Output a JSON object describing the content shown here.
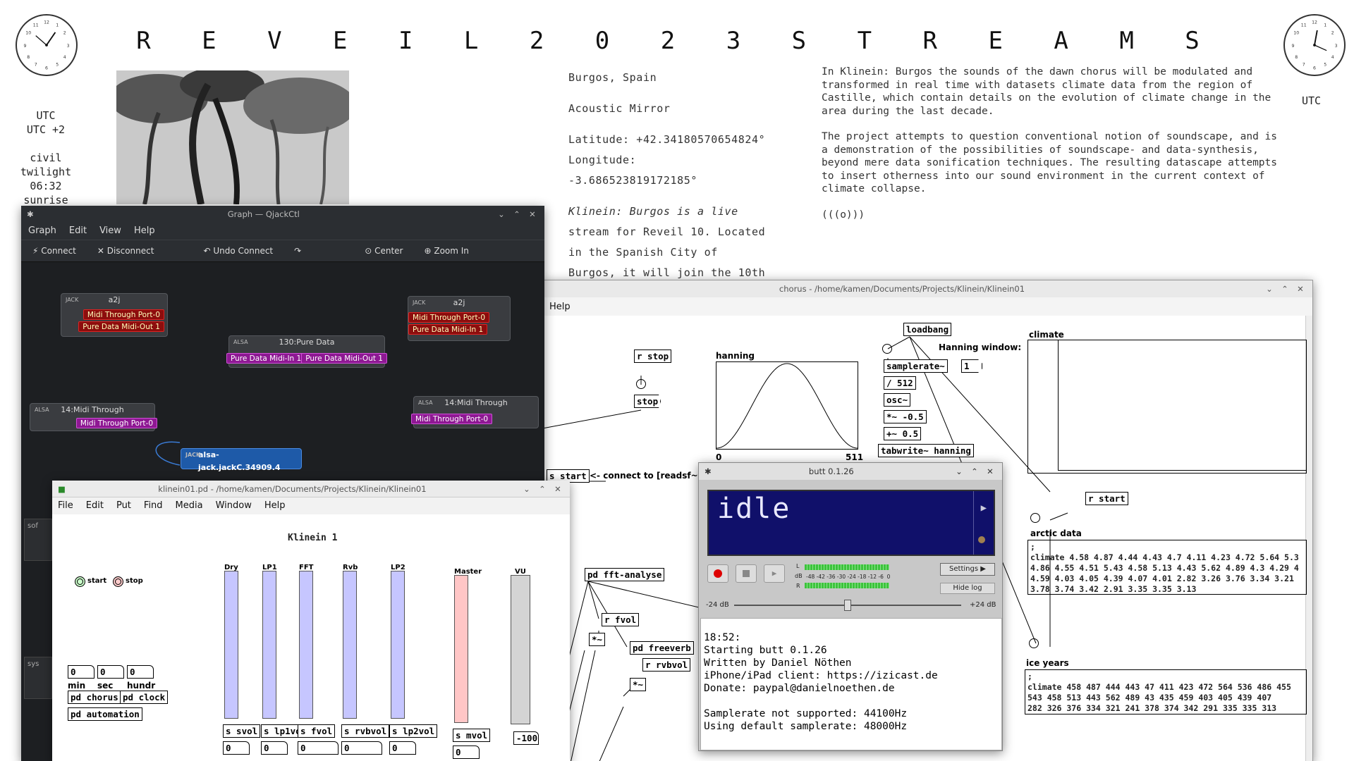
{
  "page": {
    "title": "R E V E I L   2 0 2 3   S T R E A M S",
    "left_labels": [
      "UTC",
      "UTC +2",
      "",
      "civil",
      "twilight",
      "06:32",
      "sunrise"
    ],
    "right_label": "UTC",
    "info_lines": [
      "Burgos, Spain",
      "",
      "Acoustic Mirror",
      "",
      "Latitude: +42.34180570654824°",
      "Longitude:",
      "-3.686523819172185°",
      "",
      "Klinein: Burgos is a live",
      "stream for Reveil 10. Located",
      "in the Spanish City of",
      "Burgos, it will join the 10th"
    ],
    "desc_p1": "In Klinein: Burgos the sounds of the dawn chorus will be modulated and transformed in real time with datasets climate data from the region of Castille, which contain details on the evolution of climate change in the area during the last decade.",
    "desc_p2": "The project attempts to question conventional notion of soundscape, and is a demonstration of the possibilities of soundscape- and data-synthesis, beyond mere data sonification techniques. The resulting datascape attempts to insert otherness into our sound environment in the current context of climate collapse.",
    "desc_p3": "(((o)))"
  },
  "qjackctl": {
    "title": "Graph — QjackCtl",
    "menu": [
      "Graph",
      "Edit",
      "View",
      "Help"
    ],
    "toolbar": {
      "connect": "Connect",
      "disconnect": "Disconnect",
      "undo": "Undo Connect",
      "center": "Center",
      "zoom_in": "Zoom In"
    },
    "nodes": {
      "a2j_left": {
        "name": "a2j",
        "ports": [
          "Midi Through Port-0",
          "Pure Data Midi-Out 1"
        ]
      },
      "a2j_right": {
        "name": "a2j",
        "ports": [
          "Midi Through Port-0",
          "Pure Data Midi-In 1"
        ]
      },
      "pure_data": {
        "name": "130:Pure Data",
        "ports": [
          "Pure Data Midi-In 1",
          "Pure Data Midi-Out 1"
        ]
      },
      "midi_left": {
        "name": "14:Midi Through",
        "ports": [
          "Midi Through Port-0"
        ]
      },
      "midi_right": {
        "name": "14:Midi Through",
        "ports": [
          "Midi Through Port-0"
        ]
      },
      "alsa": {
        "name": "alsa-jack.jackC.34909.4"
      },
      "side": [
        "sof",
        "sys"
      ]
    }
  },
  "pd_main": {
    "title": "klinein01.pd  - /home/kamen/Documents/Projects/Klinein/Klinein01",
    "menu": [
      "File",
      "Edit",
      "Put",
      "Find",
      "Media",
      "Window",
      "Help"
    ],
    "heading": "Klinein 1",
    "start": "start",
    "stop": "stop",
    "channels": [
      {
        "label": "Dry",
        "send": "s svol",
        "value": "0"
      },
      {
        "label": "LP1",
        "send": "s lp1vol",
        "value": "0"
      },
      {
        "label": "FFT",
        "send": "s fvol",
        "value": "0"
      },
      {
        "label": "Rvb",
        "send": "s rvbvol",
        "value": "0"
      },
      {
        "label": "LP2",
        "send": "s lp2vol",
        "value": "0"
      },
      {
        "label": "Master",
        "send": "s mvol",
        "value": "0"
      }
    ],
    "vu_label": "VU",
    "vu_value": "-100",
    "time_values": [
      "0",
      "0",
      "0"
    ],
    "time_labels": [
      "min",
      "sec",
      "hundr"
    ],
    "buttons": [
      "pd chorus",
      "pd clock",
      "pd automation"
    ]
  },
  "pd_chorus": {
    "title": "chorus  - /home/kamen/Documents/Projects/Klinein/Klinein01",
    "menu_help": "Help",
    "objects": {
      "r_stop": "r stop",
      "stop_msg": "stop",
      "hanning": "hanning",
      "h0": "0",
      "h511": "511",
      "loadbang": "loadbang",
      "hanning_window": "Hanning window:",
      "samplerate": "samplerate~",
      "one": "1",
      "div512": "/ 512",
      "osc": "osc~",
      "mul": "*~ -0.5",
      "add": "+~ 0.5",
      "tabwrite": "tabwrite~ hanning",
      "climate": "climate",
      "r_start": "r start",
      "s_start": "s start",
      "connect_note": "<- connect to [readsf~",
      "pd_fft": "pd fft-analyse",
      "r_fvol": "r fvol",
      "pd_freeverb": "pd freeverb",
      "r_rvbvol": "r rvbvol",
      "mul1": "*~",
      "mul2": "*~",
      "arctic": "arctic data",
      "ice": "ice years"
    },
    "climate_lines": [
      ";",
      "climate 4.58 4.87 4.44 4.43 4.7 4.11 4.23 4.72 5.64 5.3",
      "4.86 4.55 4.51 5.43 4.58 5.13 4.43 5.62 4.89 4.3 4.29 4",
      "4.59 4.03 4.05 4.39 4.07 4.01 2.82 3.26 3.76 3.34 3.21",
      "3.78 3.74 3.42 2.91 3.35 3.35 3.13"
    ],
    "ice_lines": [
      ";",
      "climate 458 487 444 443 47 411 423 472 564 536 486 455",
      "543 458 513 443 562 489 43 435 459 403 405 439 407",
      "282 326 376 334 321 241 378 374 342 291 335 335 313"
    ]
  },
  "butt": {
    "title": "butt 0.1.26",
    "status": "idle",
    "meter_scale": "-48 -42 -36 -30 -24 -18 -12 -6  0",
    "db_unit": "dB",
    "left": "L",
    "right": "R",
    "settings": "Settings",
    "hide_log": "Hide log",
    "gain_min": "-24 dB",
    "gain_max": "+24 dB",
    "gain_level": 0.5,
    "log": "18:52:\nStarting butt 0.1.26\nWritten by Daniel Nöthen\niPhone/iPad client: https://izicast.de\nDonate: paypal@danielnoethen.de\n\nSamplerate not supported: 44100Hz\nUsing default samplerate: 48000Hz"
  }
}
